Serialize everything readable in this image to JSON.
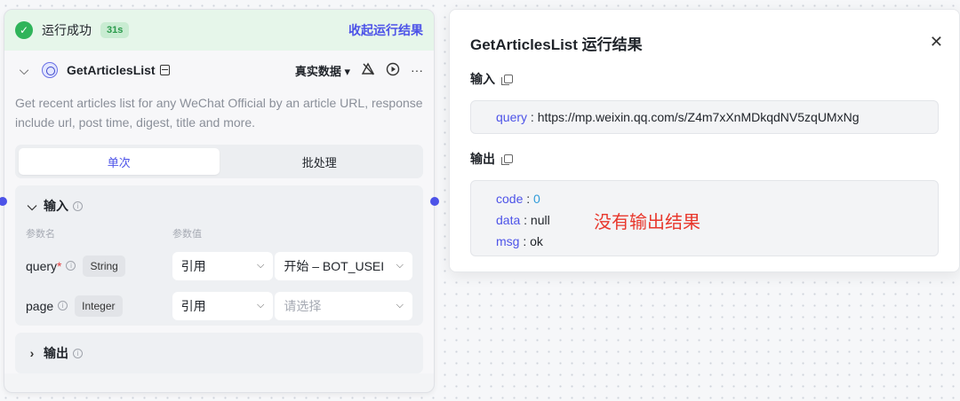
{
  "node": {
    "status_text": "运行成功",
    "time_badge": "31s",
    "collapse_label": "收起运行结果",
    "title": "GetArticlesList",
    "mode_label": "真实数据",
    "description": "Get recent articles list for any WeChat Official by an article URL, response include url, post time, digest, title and more.",
    "tabs": [
      {
        "label": "单次",
        "active": true
      },
      {
        "label": "批处理",
        "active": false
      }
    ],
    "input_section": {
      "title": "输入",
      "col_name": "参数名",
      "col_value": "参数值",
      "params": [
        {
          "name": "query",
          "required": true,
          "type": "String",
          "source": "引用",
          "value": "开始 – BOT_USEI",
          "placeholder": ""
        },
        {
          "name": "page",
          "required": false,
          "type": "Integer",
          "source": "引用",
          "value": "",
          "placeholder": "请选择"
        }
      ]
    },
    "output_section": {
      "title": "输出"
    }
  },
  "result_panel": {
    "title": "GetArticlesList 运行结果",
    "input_label": "输入",
    "input": {
      "key": "query",
      "sep": " : ",
      "value": "https://mp.weixin.qq.com/s/Z4m7xXnMDkqdNV5zqUMxNg"
    },
    "output_label": "输出",
    "output": [
      {
        "key": "code",
        "sep": " : ",
        "value": "0"
      },
      {
        "key": "data",
        "sep": " : ",
        "value": "null"
      },
      {
        "key": "msg",
        "sep": " : ",
        "value": "ok"
      }
    ],
    "annotation": "没有输出结果"
  },
  "colors": {
    "accent": "#4d53e8",
    "success": "#2fb45a",
    "annotation": "#e8382d"
  },
  "icons": [
    "check-circle-icon",
    "chevron-down-icon",
    "plugin-icon",
    "doc-icon",
    "caret-down-icon",
    "no-alert-icon",
    "play-icon",
    "more-icon",
    "info-icon",
    "chevron-right-icon",
    "copy-icon",
    "close-icon"
  ]
}
